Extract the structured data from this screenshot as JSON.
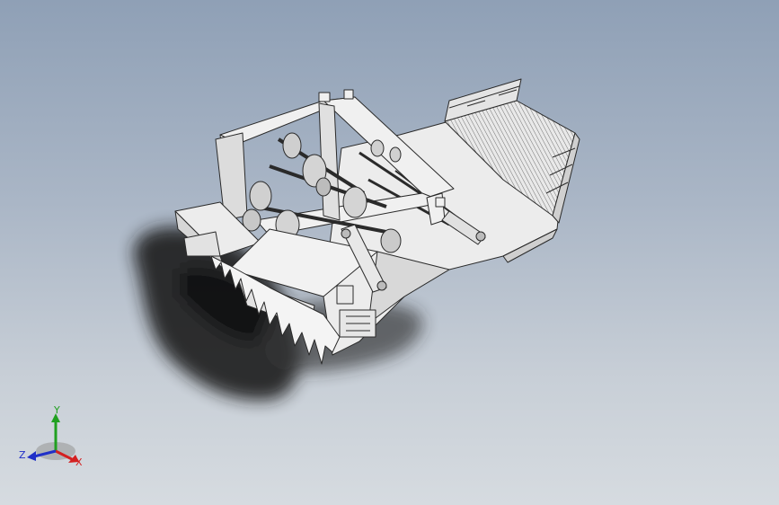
{
  "viewport": {
    "background_top": "#8fa0b6",
    "background_bottom": "#d6dbe0",
    "model_color": "#e8e8e8",
    "edge_color": "#2a2a2a"
  },
  "triad": {
    "x_label": "X",
    "y_label": "Y",
    "z_label": "Z",
    "x_color": "#d42020",
    "y_color": "#20a020",
    "z_color": "#2030c8"
  }
}
